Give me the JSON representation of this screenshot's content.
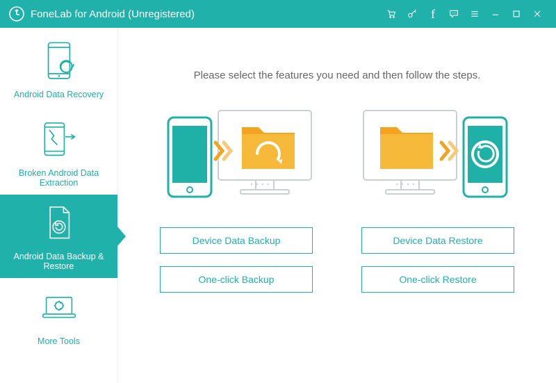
{
  "app": {
    "title": "FoneLab for Android (Unregistered)"
  },
  "sidebar": {
    "items": [
      {
        "label": "Android Data Recovery"
      },
      {
        "label": "Broken Android Data Extraction"
      },
      {
        "label": "Android Data Backup & Restore"
      },
      {
        "label": "More Tools"
      }
    ],
    "activeIndex": 2
  },
  "main": {
    "instruction": "Please select the features you need and then follow the steps.",
    "options": [
      {
        "label": "Device Data Backup"
      },
      {
        "label": "Device Data Restore"
      },
      {
        "label": "One-click Backup"
      },
      {
        "label": "One-click Restore"
      }
    ]
  }
}
